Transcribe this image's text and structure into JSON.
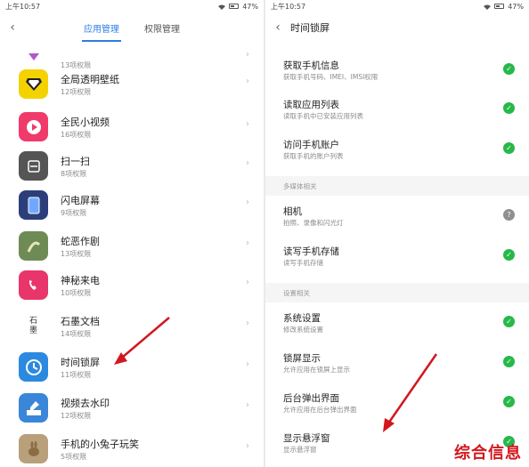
{
  "left": {
    "status": {
      "time": "上午10:57",
      "battery": "47%"
    },
    "tabs": [
      "应用管理",
      "权限管理"
    ],
    "apps": [
      {
        "name": "",
        "sub": "13项权限",
        "icon": "partial-app-icon",
        "color": "#ffffff"
      },
      {
        "name": "全局透明壁纸",
        "sub": "12项权限",
        "icon": "diamond-icon",
        "color": "#f4d200"
      },
      {
        "name": "全民小视频",
        "sub": "16项权限",
        "icon": "play-icon",
        "color": "#f03a6a"
      },
      {
        "name": "扫一扫",
        "sub": "8项权限",
        "icon": "scan-icon",
        "color": "#555555"
      },
      {
        "name": "闪电屏幕",
        "sub": "9项权限",
        "icon": "screen-icon",
        "color": "#2c3e7a"
      },
      {
        "name": "蛇恶作剧",
        "sub": "13项权限",
        "icon": "snake-icon",
        "color": "#6f8b55"
      },
      {
        "name": "神秘来电",
        "sub": "10项权限",
        "icon": "phone-icon",
        "color": "#e8356a"
      },
      {
        "name": "石墨文档",
        "sub": "14项权限",
        "icon": "shimo-icon",
        "color": "#ffffff"
      },
      {
        "name": "时间锁屏",
        "sub": "11项权限",
        "icon": "clock-icon",
        "color": "#2b8ae0"
      },
      {
        "name": "视频去水印",
        "sub": "12项权限",
        "icon": "watermark-icon",
        "color": "#3a86d8"
      },
      {
        "name": "手机的小兔子玩笑",
        "sub": "5项权限",
        "icon": "rabbit-icon",
        "color": "#b8a07a"
      }
    ],
    "shimo_glyph": "石\n墨"
  },
  "right": {
    "status": {
      "time": "上午10:57",
      "battery": "47%"
    },
    "title": "时间锁屏",
    "items_top": [
      {
        "name": "获取手机信息",
        "sub": "获取手机号码、IMEI、IMSI权限",
        "state": "allowed"
      },
      {
        "name": "读取应用列表",
        "sub": "读取手机中已安装应用列表",
        "state": "allowed"
      },
      {
        "name": "访问手机账户",
        "sub": "获取手机的账户列表",
        "state": "allowed"
      }
    ],
    "section_media": "多媒体相关",
    "items_media": [
      {
        "name": "相机",
        "sub": "拍照、录像和闪光灯",
        "state": "ask"
      },
      {
        "name": "读写手机存储",
        "sub": "读写手机存储",
        "state": "allowed"
      }
    ],
    "section_settings": "设置相关",
    "items_settings": [
      {
        "name": "系统设置",
        "sub": "修改系统设置",
        "state": "allowed"
      },
      {
        "name": "锁屏显示",
        "sub": "允许应用在锁屏上显示",
        "state": "allowed"
      },
      {
        "name": "后台弹出界面",
        "sub": "允许应用在后台弹出界面",
        "state": "allowed"
      },
      {
        "name": "显示悬浮窗",
        "sub": "显示悬浮窗",
        "state": "allowed"
      }
    ]
  },
  "watermark": "综合信息",
  "arrow_color": "#d2171e",
  "check_glyph": "✓",
  "ask_glyph": "?"
}
